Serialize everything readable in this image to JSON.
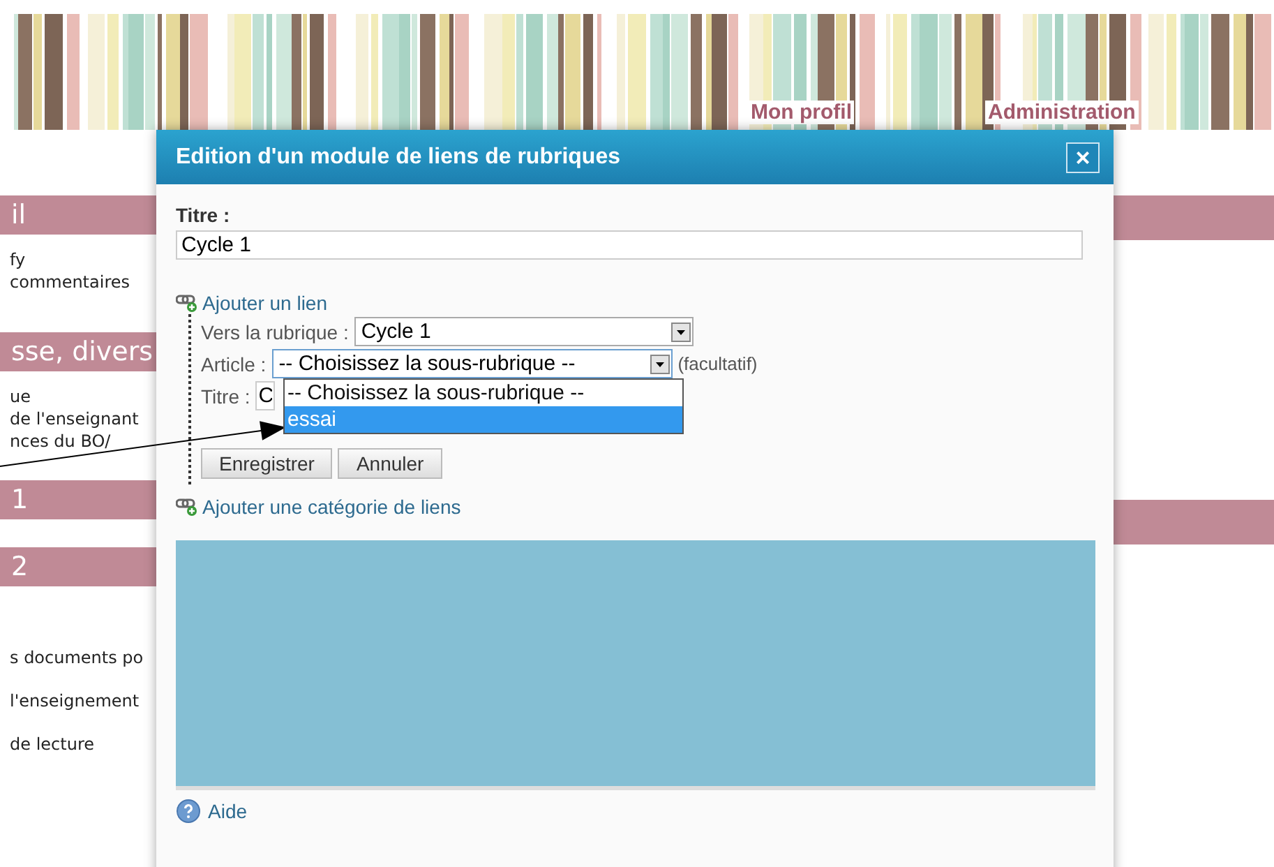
{
  "nav": [
    "Mon profil",
    "Administration"
  ],
  "left_column": [
    {
      "heading": "il",
      "lines": [
        "fy",
        "commentaires"
      ]
    },
    {
      "heading": "sse, divers",
      "lines": [
        "ue",
        "de l'enseignant",
        "nces  du  BO/"
      ]
    },
    {
      "heading": "1"
    },
    {
      "heading": "2"
    },
    {
      "lines": [
        "s documents po",
        "l'enseignement",
        "de lecture"
      ]
    }
  ],
  "dialog": {
    "title": "Edition d'un module de liens de rubriques",
    "close": "×",
    "title_field": {
      "label": "Titre :",
      "value": "Cycle 1"
    },
    "add_link": "Ajouter un lien",
    "link_form": {
      "rubrique_label": "Vers la rubrique :",
      "rubrique_value": "Cycle 1",
      "article_label": "Article :",
      "article_value": "-- Choisissez la sous-rubrique --",
      "article_note": "(facultatif)",
      "article_expanded": true,
      "options": [
        {
          "label": "-- Choisissez la sous-rubrique --",
          "selected": false
        },
        {
          "label": "essai",
          "selected": true
        }
      ],
      "titre_label": "Titre :",
      "titre_value": "C",
      "buttons": [
        "Enregistrer",
        "Annuler"
      ]
    },
    "add_category": "Ajouter une catégorie de liens",
    "help": "Aide"
  }
}
